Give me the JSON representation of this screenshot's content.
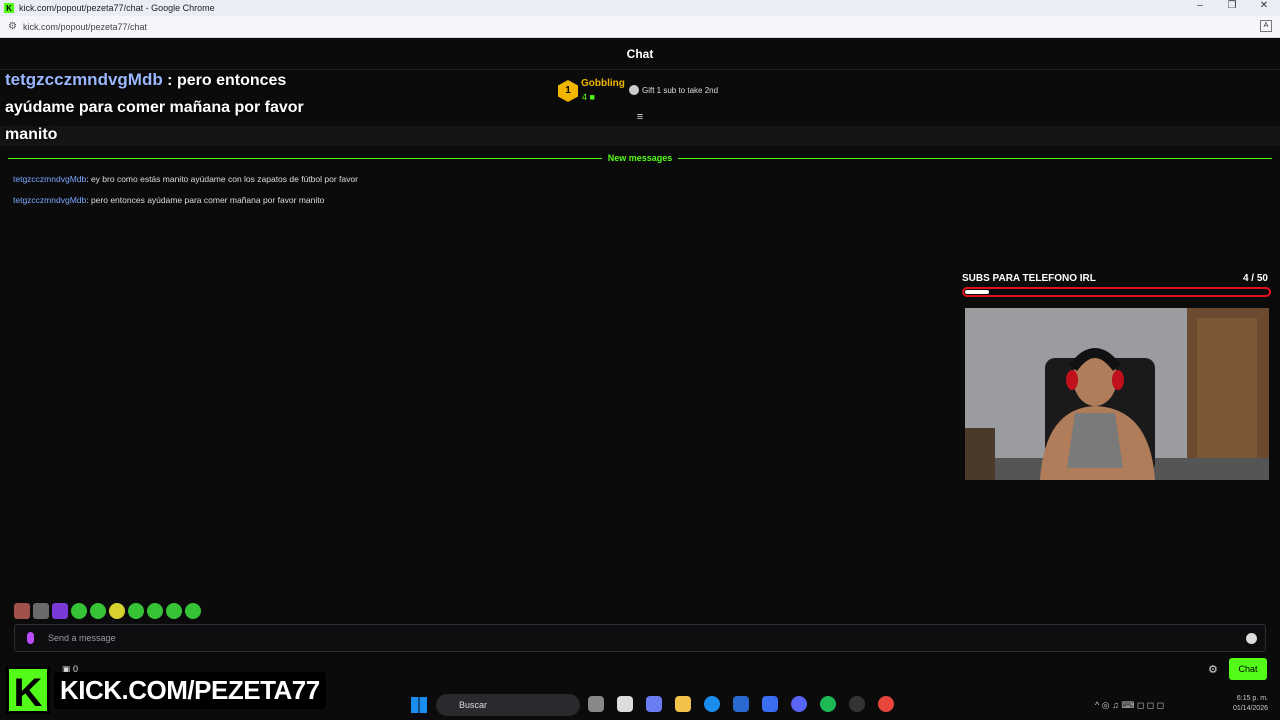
{
  "window": {
    "title": "kick.com/popout/pezeta77/chat - Google Chrome",
    "url": "kick.com/popout/pezeta77/chat"
  },
  "chat": {
    "header": "Chat"
  },
  "overlay_message": {
    "user": "tetgzcczmndvgMdb",
    "text": " : pero entonces ayúdame para comer mañana por favor manito"
  },
  "pinned": {
    "rank": "1",
    "gifter_name": "Gobbling",
    "gifter_count": "4",
    "gift_cta": "Gift 1 sub to take 2nd"
  },
  "new_messages_label": "New messages",
  "messages": [
    {
      "user": "tetgzcczmndvgMdb",
      "text": ": ey bro como estás manito ayúdame con los zapatos de fútbol por favor"
    },
    {
      "user": "tetgzcczmndvgMdb",
      "text": ": pero entonces ayúdame para comer mañana por favor manito"
    }
  ],
  "goal": {
    "title": "SUBS PARA TELEFONO IRL",
    "current": 4,
    "target": 50,
    "count_label": "4  / 50",
    "fraction": 0.08
  },
  "input": {
    "placeholder": "Send a message"
  },
  "footer": {
    "points": "0",
    "chat_button": "Chat"
  },
  "brand": {
    "k": "K",
    "text": "KICK.COM/PEZETA77"
  },
  "taskbar": {
    "search_label": "Buscar",
    "time": "6:15 p. m.",
    "date": "01/14/2026"
  },
  "colors": {
    "kick_green": "#53fc18",
    "goal_red": "#e0101c",
    "username_blue": "#7aa7ff"
  }
}
